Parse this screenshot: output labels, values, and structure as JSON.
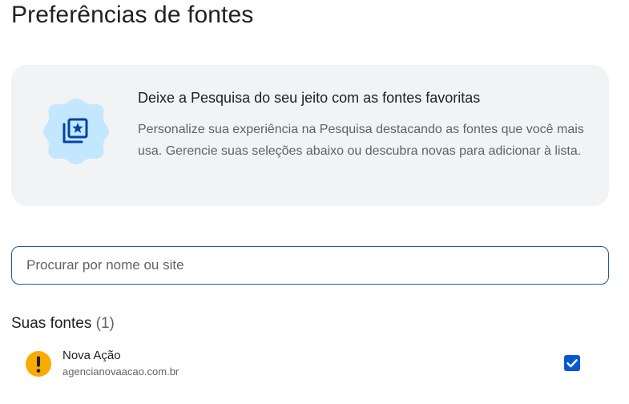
{
  "page": {
    "title": "Preferências de fontes"
  },
  "promo": {
    "icon": "bookmark-star-photos-icon",
    "heading": "Deixe a Pesquisa do seu jeito com as fontes favoritas",
    "body": "Personalize sua experiência na Pesquisa destacando as fontes que você mais usa. Gerencie suas seleções abaixo ou descubra novas para adicionar à lista.",
    "badge_color": "#c2e7ff",
    "icon_color": "#0842a0"
  },
  "search": {
    "placeholder": "Procurar por nome ou site",
    "value": ""
  },
  "your_sources": {
    "label": "Suas fontes",
    "count": "(1)",
    "items": [
      {
        "name": "Nova Ação",
        "url": "agencianovaacao.com.br",
        "icon": "warning-exclamation-icon",
        "icon_color": "#f9ab00",
        "checked": true
      }
    ]
  },
  "colors": {
    "accent": "#0b57d0",
    "card_background": "#f1f3f4",
    "search_border": "#1a57a8"
  }
}
